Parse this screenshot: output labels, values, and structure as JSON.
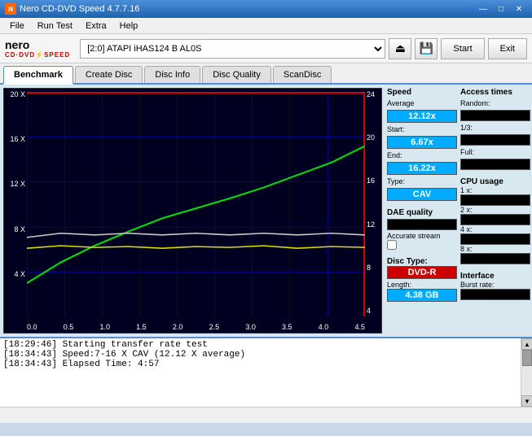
{
  "titleBar": {
    "title": "Nero CD-DVD Speed 4.7.7.16",
    "controls": {
      "minimize": "—",
      "maximize": "□",
      "close": "✕"
    }
  },
  "menuBar": {
    "items": [
      "File",
      "Run Test",
      "Extra",
      "Help"
    ]
  },
  "toolbar": {
    "logoTop": "nero",
    "logoBottom": "CD·DVD⚡SPEED",
    "driveLabel": "[2:0]  ATAPI iHAS124  B AL0S",
    "startBtn": "Start",
    "exitBtn": "Exit"
  },
  "tabs": [
    {
      "label": "Benchmark",
      "active": true
    },
    {
      "label": "Create Disc",
      "active": false
    },
    {
      "label": "Disc Info",
      "active": false
    },
    {
      "label": "Disc Quality",
      "active": false
    },
    {
      "label": "ScanDisc",
      "active": false
    }
  ],
  "chart": {
    "yLabels": [
      "20 X",
      "16 X",
      "12 X",
      "8 X",
      "4 X",
      ""
    ],
    "yLabelsRight": [
      "24",
      "20",
      "16",
      "12",
      "8",
      "4"
    ],
    "xLabels": [
      "0.0",
      "0.5",
      "1.0",
      "1.5",
      "2.0",
      "2.5",
      "3.0",
      "3.5",
      "4.0",
      "4.5"
    ]
  },
  "rightPanel": {
    "speedSection": {
      "label": "Speed",
      "averageLabel": "Average",
      "averageValue": "12.12x",
      "startLabel": "Start:",
      "startValue": "6.67x",
      "endLabel": "End:",
      "endValue": "16.22x",
      "typeLabel": "Type:",
      "typeValue": "CAV"
    },
    "daeSection": {
      "label": "DAE quality",
      "accurateStreamLabel": "Accurate stream"
    },
    "discSection": {
      "typeLabel": "Disc Type:",
      "typeValue": "DVD-R",
      "lengthLabel": "Length:",
      "lengthValue": "4.38 GB"
    },
    "accessSection": {
      "label": "Access times",
      "randomLabel": "Random:",
      "thirdLabel": "1/3:",
      "fullLabel": "Full:"
    },
    "cpuSection": {
      "label": "CPU usage",
      "x1Label": "1 x:",
      "x2Label": "2 x:",
      "x4Label": "4 x:",
      "x8Label": "8 x:"
    },
    "interfaceSection": {
      "label": "Interface",
      "burstLabel": "Burst rate:"
    }
  },
  "log": {
    "lines": [
      "[18:29:46]  Starting transfer rate test",
      "[18:34:43]  Speed:7-16 X CAV (12.12 X average)",
      "[18:34:43]  Elapsed Time: 4:57"
    ]
  }
}
